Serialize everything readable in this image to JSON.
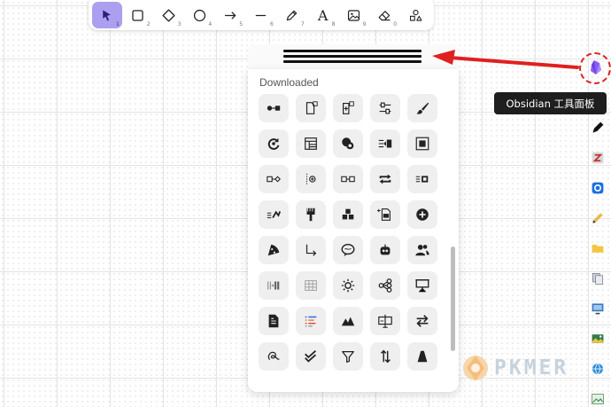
{
  "toolbar": {
    "tools": [
      {
        "name": "selection",
        "shortcut": "1",
        "active": true,
        "icon": "pointer-icon"
      },
      {
        "name": "rectangle",
        "shortcut": "2",
        "icon": "square-icon"
      },
      {
        "name": "diamond",
        "shortcut": "3",
        "icon": "diamond-icon"
      },
      {
        "name": "ellipse",
        "shortcut": "4",
        "icon": "circle-icon"
      },
      {
        "name": "arrow",
        "shortcut": "5",
        "icon": "arrow-right-icon"
      },
      {
        "name": "line",
        "shortcut": "6",
        "icon": "line-icon"
      },
      {
        "name": "draw",
        "shortcut": "7",
        "icon": "pencil-icon"
      },
      {
        "name": "text",
        "shortcut": "8",
        "glyph": "A",
        "icon": "text-icon"
      },
      {
        "name": "image",
        "shortcut": "9",
        "icon": "image-icon"
      },
      {
        "name": "eraser",
        "shortcut": "0",
        "icon": "eraser-icon"
      },
      {
        "name": "shapes",
        "shortcut": "",
        "icon": "shapes-icon"
      }
    ],
    "accent_color": "#ac9ff0"
  },
  "panel": {
    "title": "Downloaded",
    "icons": [
      "node-connector-icon",
      "file-link-icon",
      "file-add-icon",
      "sliders-icon",
      "brush-icon",
      "refresh-icon",
      "layout-icon",
      "blob-icon",
      "split-icon",
      "frame-icon",
      "box-connector-icon",
      "focus-icon",
      "box-link-icon",
      "repeat-icon",
      "stack-icon",
      "scatter-icon",
      "paintbrush-icon",
      "blocks-icon",
      "file-text-icon",
      "plus-circle-icon",
      "pizza-icon",
      "corner-arrow-icon",
      "speech-icon",
      "robot-icon",
      "users-icon",
      "columns-icon",
      "table-grid-icon",
      "sun-icon",
      "tree-icon",
      "presentation-icon",
      "document-icon",
      "list-icon",
      "mountain-icon",
      "screen-icon",
      "swap-icon",
      "signature-icon",
      "double-check-icon",
      "filter-icon",
      "vertical-arrows-icon",
      "cone-icon"
    ]
  },
  "sidebar": {
    "tooltip": "Obsidian 工具面板",
    "obsidian_icon": "obsidian-icon",
    "icons": [
      "pen-icon",
      "zotero-icon",
      "browser-icon",
      "pencil-icon",
      "folder-icon",
      "files-icon",
      "monitor-icon",
      "gallery-icon",
      "globe-icon",
      "image-icon"
    ]
  },
  "watermark": {
    "text": "PKMER"
  },
  "colors": {
    "annotation_red": "#e02020",
    "tooltip_bg": "#1e1e1e"
  }
}
